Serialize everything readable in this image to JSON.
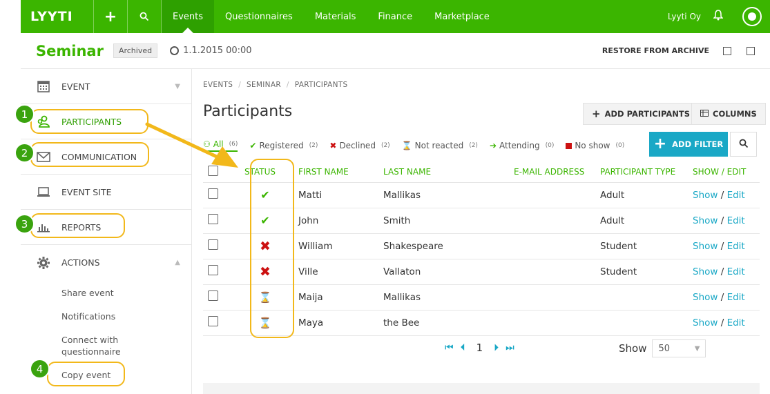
{
  "nav": {
    "logo": "LYYTI",
    "links": [
      "Events",
      "Questionnaires",
      "Materials",
      "Finance",
      "Marketplace"
    ],
    "org": "Lyyti Oy"
  },
  "event": {
    "title": "Seminar",
    "badge": "Archived",
    "datetime": "1.1.2015 00:00",
    "restore": "RESTORE FROM ARCHIVE"
  },
  "sidebar": {
    "items": [
      {
        "label": "EVENT",
        "icon": "calendar-icon"
      },
      {
        "label": "PARTICIPANTS",
        "icon": "participants-icon"
      },
      {
        "label": "COMMUNICATION",
        "icon": "envelope-icon"
      },
      {
        "label": "EVENT SITE",
        "icon": "laptop-icon"
      },
      {
        "label": "REPORTS",
        "icon": "bar-chart-icon"
      },
      {
        "label": "ACTIONS",
        "icon": "gear-icon"
      }
    ],
    "actions": [
      "Share event",
      "Notifications",
      "Connect with questionnaire",
      "Copy event"
    ]
  },
  "breadcrumb": [
    "EVENTS",
    "SEMINAR",
    "PARTICIPANTS"
  ],
  "page_title": "Participants",
  "toolbar": {
    "add_participants": "ADD PARTICIPANTS",
    "columns": "COLUMNS",
    "add_filter": "ADD FILTER"
  },
  "filters": [
    {
      "label": "All",
      "count": "(6)"
    },
    {
      "label": "Registered",
      "count": "(2)"
    },
    {
      "label": "Declined",
      "count": "(2)"
    },
    {
      "label": "Not reacted",
      "count": "(2)"
    },
    {
      "label": "Attending",
      "count": "(0)"
    },
    {
      "label": "No show",
      "count": "(0)"
    }
  ],
  "table": {
    "headers": [
      "STATUS",
      "FIRST NAME",
      "LAST NAME",
      "E-MAIL ADDRESS",
      "PARTICIPANT TYPE",
      "SHOW / EDIT"
    ],
    "rows": [
      {
        "status": "✔",
        "first": "Matti",
        "last": "Mallikas",
        "email": "",
        "type": "Adult"
      },
      {
        "status": "✔",
        "first": "John",
        "last": "Smith",
        "email": "",
        "type": "Adult"
      },
      {
        "status": "✖",
        "first": "William",
        "last": "Shakespeare",
        "email": "",
        "type": "Student"
      },
      {
        "status": "✖",
        "first": "Ville",
        "last": "Vallaton",
        "email": "",
        "type": "Student"
      },
      {
        "status": "⌛",
        "first": "Maija",
        "last": "Mallikas",
        "email": "",
        "type": ""
      },
      {
        "status": "⌛",
        "first": "Maya",
        "last": "the Bee",
        "email": "",
        "type": ""
      }
    ],
    "show": "Show",
    "edit": "Edit"
  },
  "pager": {
    "page": "1",
    "show_label": "Show",
    "page_size": "50"
  },
  "annotations": [
    "1",
    "2",
    "3",
    "4"
  ],
  "colors": {
    "brand": "#3bb500",
    "accent": "#1aa8c6",
    "highlight": "#f2b81a",
    "decline": "#cc1111"
  }
}
